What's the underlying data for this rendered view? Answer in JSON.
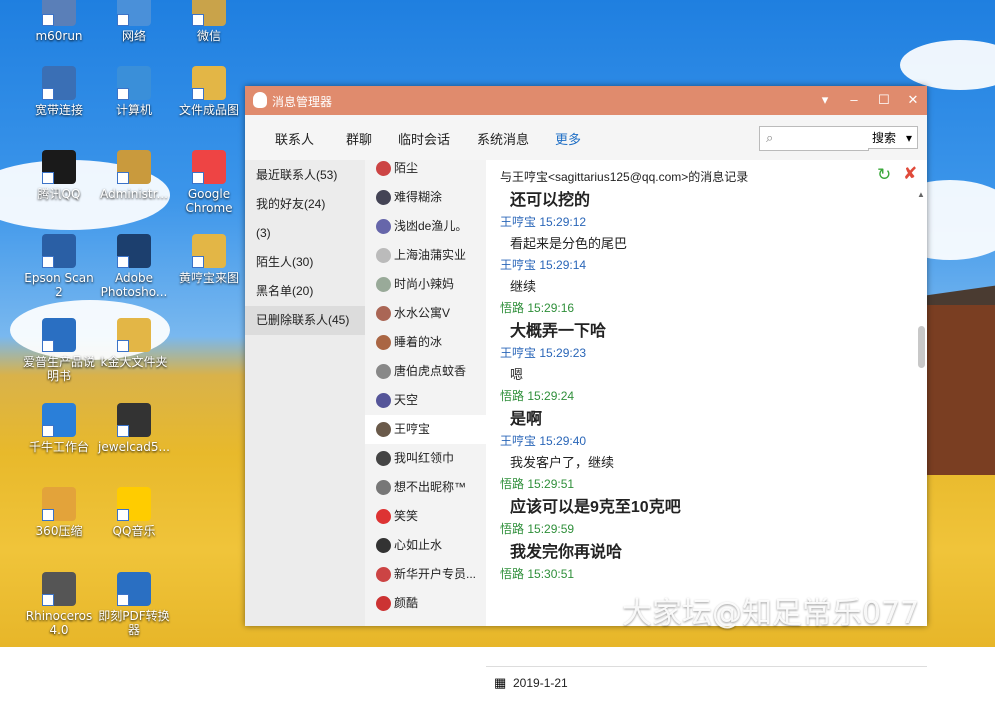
{
  "desktop_icons": [
    {
      "label": "m60run"
    },
    {
      "label": "网络"
    },
    {
      "label": "微信"
    },
    {
      "label": "宽带连接"
    },
    {
      "label": "计算机"
    },
    {
      "label": "文件成品图"
    },
    {
      "label": "腾讯QQ"
    },
    {
      "label": "Administr..."
    },
    {
      "label": "Google Chrome"
    },
    {
      "label": "Epson Scan 2"
    },
    {
      "label": "Adobe Photosho..."
    },
    {
      "label": "黄哼宝来图"
    },
    {
      "label": "爱普生产品说明书"
    },
    {
      "label": "k金大文件夹"
    },
    {
      "label": "千牛工作台"
    },
    {
      "label": "jewelcad5..."
    },
    {
      "label": "360压缩"
    },
    {
      "label": "QQ音乐"
    },
    {
      "label": "Rhinoceros 4.0"
    },
    {
      "label": "即刻PDF转换器"
    }
  ],
  "window": {
    "title": "消息管理器"
  },
  "nav": {
    "tabs": [
      "联系人",
      "群聊",
      "临时会话",
      "系统消息",
      "更多"
    ],
    "search_label": "搜索"
  },
  "categories": [
    "最近联系人(53)",
    "我的好友(24)",
    "(3)",
    "陌生人(30)",
    "黑名单(20)",
    "已删除联系人(45)"
  ],
  "contacts": [
    "陌尘",
    "难得糊涂",
    "浅凼de渔儿。",
    "上海油蒲实业",
    "时尚小辣妈",
    "水水公寓V",
    "睡着的冰",
    "唐伯虎点蚊香",
    "天空",
    "王哼宝",
    "我叫红领巾",
    "想不出昵称™",
    "笑笑",
    "心如止水",
    "新华开户专员...",
    "颜酷"
  ],
  "history": {
    "title": "与王哼宝<sagittarius125@qq.com>的消息记录",
    "messages": [
      {
        "sender": "",
        "time": "",
        "text": "还可以挖的",
        "big": true
      },
      {
        "sender": "王哼宝",
        "time": "15:29:12",
        "text": "看起来是分色的尾巴",
        "big": false
      },
      {
        "sender": "王哼宝",
        "time": "15:29:14",
        "text": "继续",
        "big": false
      },
      {
        "sender": "悟路",
        "time": "15:29:16",
        "text": "大概弄一下哈",
        "big": true
      },
      {
        "sender": "王哼宝",
        "time": "15:29:23",
        "text": "嗯",
        "big": false
      },
      {
        "sender": "悟路",
        "time": "15:29:24",
        "text": "是啊",
        "big": true
      },
      {
        "sender": "王哼宝",
        "time": "15:29:40",
        "text": "我发客户了，继续",
        "big": false
      },
      {
        "sender": "悟路",
        "time": "15:29:51",
        "text": "应该可以是9克至10克吧",
        "big": true
      },
      {
        "sender": "悟路",
        "time": "15:29:59",
        "text": "我发完你再说哈",
        "big": true
      },
      {
        "sender": "悟路",
        "time": "15:30:51",
        "text": "",
        "big": false
      }
    ],
    "date": "2019-1-21"
  },
  "watermark": "大家坛@知足常乐077",
  "colors": {
    "titlebar": "#e08b6d",
    "peer": "#2a66b8",
    "self": "#2f8f3a"
  }
}
